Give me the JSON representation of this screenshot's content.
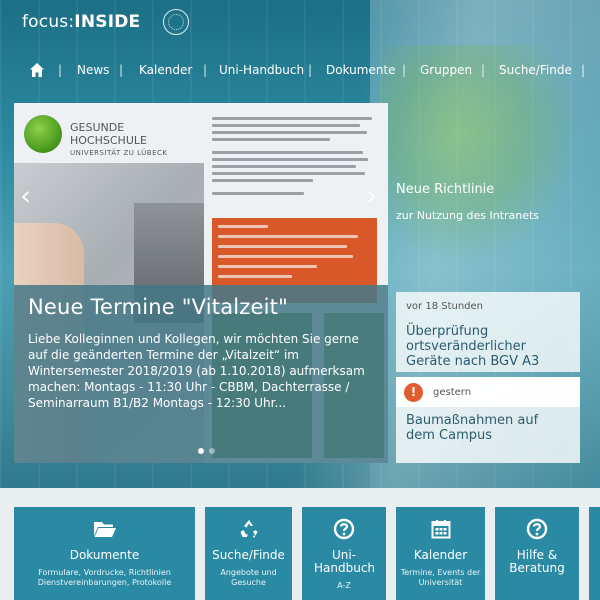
{
  "header": {
    "logo_prefix": "focus:",
    "logo_suffix": "INSIDE"
  },
  "nav": {
    "home_icon": "home-icon",
    "items": [
      "News",
      "Kalender",
      "Uni-Handbuch",
      "Dokumente",
      "Gruppen",
      "Suche/Finde"
    ]
  },
  "slider": {
    "slide_brand_line1": "GESUNDE",
    "slide_brand_line2": "HOCHSCHULE",
    "slide_brand_line3": "UNIVERSITÄT ZU LÜBECK",
    "caption_title": "Neue Termine \"Vitalzeit\"",
    "caption_text": "Liebe Kolleginnen und Kollegen, wir möchten Sie gerne auf die geänderten Termine der „Vitalzeit“ im Wintersemester 2018/2019 (ab 1.10.2018) aufmerksam machen: Montags - 11:30 Uhr - CBBM, Dachterrasse / Seminarraum B1/B2 Montags - 12:30 Uhr..."
  },
  "news": {
    "top_title": "Neue Richtlinie",
    "top_subtitle": "zur Nutzung des Intranets",
    "item1_time": "vor 18 Stunden",
    "item1_title": "Überprüfung ortsveränderlicher Geräte nach BGV A3",
    "item2_time": "gestern",
    "item2_title": "Baumaßnahmen auf dem Campus"
  },
  "tiles": [
    {
      "label": "Dokumente",
      "sub": "Formulare, Vordrucke, Richtlinien Dienstvereinbarungen, Protokolle",
      "icon": "folder-icon"
    },
    {
      "label": "Suche/Finde",
      "sub": "Angebote und Gesuche",
      "icon": "recycle-icon"
    },
    {
      "label": "Uni-Handbuch",
      "sub": "A-Z",
      "icon": "help-circle-icon"
    },
    {
      "label": "Kalender",
      "sub": "Termine, Events der Universität",
      "icon": "calendar-icon"
    },
    {
      "label": "Hilfe & Beratung",
      "sub": "",
      "icon": "help-circle-icon"
    }
  ],
  "colors": {
    "tile": "#2a8aa4",
    "warning": "#e05c2f",
    "news_title": "#2a5c6e"
  }
}
